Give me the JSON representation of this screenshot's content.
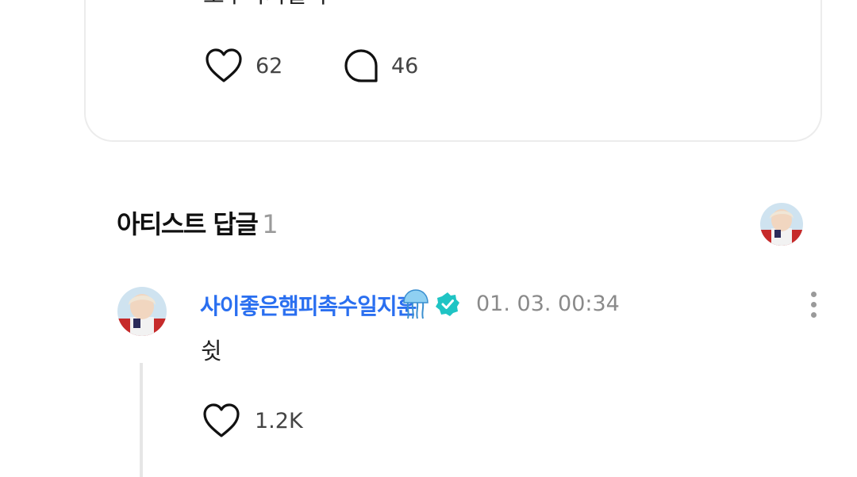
{
  "post": {
    "text": "호두과자같다",
    "likes": "62",
    "comments": "46"
  },
  "artist_section": {
    "title": "아티스트 답글",
    "count": "1"
  },
  "artist_comment": {
    "name": "사이좋은햄피촉수일지훈",
    "emoji": "🪼",
    "timestamp": "01. 03. 00:34",
    "text": "쉿",
    "likes": "1.2K"
  },
  "colors": {
    "name_blue": "#2a6ff0",
    "verified_teal": "#1fc4c4",
    "muted_gray": "#8a8a8a"
  },
  "icons": [
    "heart-icon",
    "comment-bubble-icon",
    "jellyfish-icon",
    "verified-badge-icon",
    "more-vertical-icon"
  ]
}
